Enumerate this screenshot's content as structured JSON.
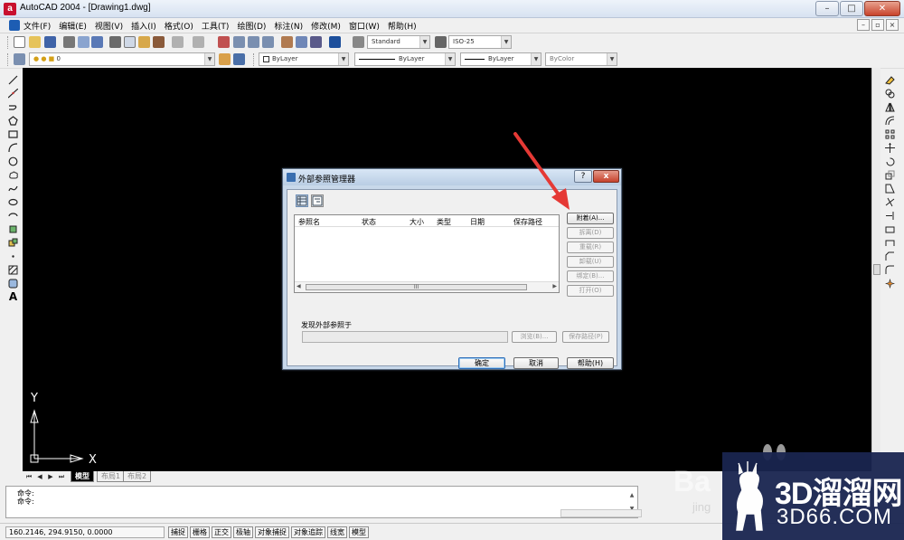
{
  "window": {
    "title": "AutoCAD 2004 - [Drawing1.dwg]",
    "app_icon_letter": "a"
  },
  "menubar": {
    "items": [
      "文件(F)",
      "编辑(E)",
      "视图(V)",
      "插入(I)",
      "格式(O)",
      "工具(T)",
      "绘图(D)",
      "标注(N)",
      "修改(M)",
      "窗口(W)",
      "帮助(H)"
    ]
  },
  "toolbar": {
    "text_style": "Standard",
    "dim_style": "ISO-25",
    "layer": "0",
    "color": "ByLayer",
    "linetype": "ByLayer",
    "lineweight": "ByLayer",
    "plotstyle": "ByColor"
  },
  "layout_tabs": [
    "模型",
    "布局1",
    "布局2"
  ],
  "command": {
    "lines": [
      "命令:",
      "命令:"
    ]
  },
  "status": {
    "coords": "160.2146, 294.9150, 0.0000",
    "buttons": [
      "捕捉",
      "栅格",
      "正交",
      "极轴",
      "对象捕捉",
      "对象追踪",
      "线宽",
      "模型"
    ]
  },
  "dialog": {
    "title": "外部参照管理器",
    "help_btn": "?",
    "close_btn": "x",
    "columns": [
      "参照名",
      "状态",
      "大小",
      "类型",
      "日期",
      "保存路径"
    ],
    "scroll_grip": "III",
    "side_buttons": {
      "attach": "附着(A)...",
      "detach": "拆离(D)",
      "reload": "重载(R)",
      "unload": "卸载(U)",
      "bind": "绑定(B)...",
      "open": "打开(O)"
    },
    "found_label": "发现外部参照于",
    "browse": "浏览(B)...",
    "save_path": "保存路径(P)",
    "ok": "确定",
    "cancel": "取消",
    "help": "帮助(H)"
  },
  "ucs": {
    "x_label": "X",
    "y_label": "Y"
  },
  "watermark": {
    "main": "3D溜溜网",
    "sub": "3D66.COM",
    "ghost": "Ba",
    "ghost_small": "jing"
  },
  "colors": {
    "canvas": "#000000",
    "dialog_frame": "#c8d8ea",
    "arrow": "#e53935",
    "watermark_bg": "#1a2550"
  }
}
